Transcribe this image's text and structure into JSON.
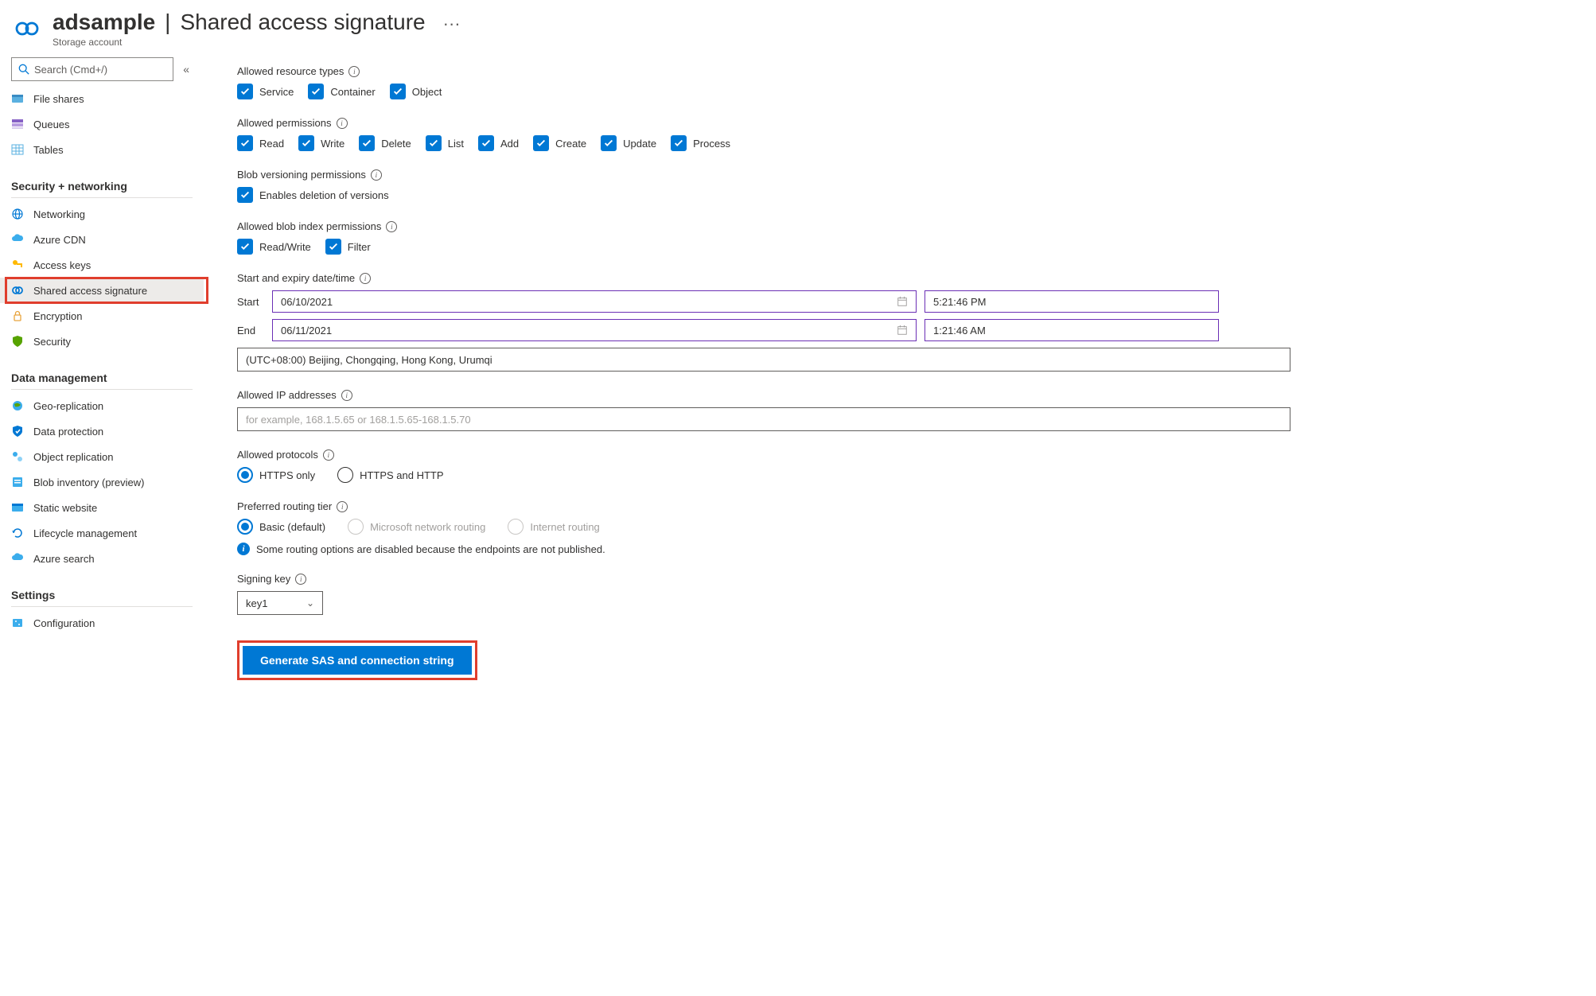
{
  "header": {
    "account_name": "adsample",
    "page_title": "Shared access signature",
    "subtitle": "Storage account"
  },
  "sidebar": {
    "search_placeholder": "Search (Cmd+/)",
    "top_items": [
      {
        "label": "File shares"
      },
      {
        "label": "Queues"
      },
      {
        "label": "Tables"
      }
    ],
    "security_section": {
      "title": "Security + networking",
      "items": [
        {
          "label": "Networking"
        },
        {
          "label": "Azure CDN"
        },
        {
          "label": "Access keys"
        },
        {
          "label": "Shared access signature"
        },
        {
          "label": "Encryption"
        },
        {
          "label": "Security"
        }
      ]
    },
    "data_section": {
      "title": "Data management",
      "items": [
        {
          "label": "Geo-replication"
        },
        {
          "label": "Data protection"
        },
        {
          "label": "Object replication"
        },
        {
          "label": "Blob inventory (preview)"
        },
        {
          "label": "Static website"
        },
        {
          "label": "Lifecycle management"
        },
        {
          "label": "Azure search"
        }
      ]
    },
    "settings_section": {
      "title": "Settings",
      "items": [
        {
          "label": "Configuration"
        }
      ]
    }
  },
  "main": {
    "allowed_resource_types": {
      "label": "Allowed resource types",
      "options": [
        "Service",
        "Container",
        "Object"
      ]
    },
    "allowed_permissions": {
      "label": "Allowed permissions",
      "options": [
        "Read",
        "Write",
        "Delete",
        "List",
        "Add",
        "Create",
        "Update",
        "Process"
      ]
    },
    "blob_versioning": {
      "label": "Blob versioning permissions",
      "option": "Enables deletion of versions"
    },
    "blob_index": {
      "label": "Allowed blob index permissions",
      "options": [
        "Read/Write",
        "Filter"
      ]
    },
    "datetime": {
      "label": "Start and expiry date/time",
      "start_label": "Start",
      "end_label": "End",
      "start_date": "06/10/2021",
      "start_time": "5:21:46 PM",
      "end_date": "06/11/2021",
      "end_time": "1:21:46 AM",
      "timezone": "(UTC+08:00) Beijing, Chongqing, Hong Kong, Urumqi"
    },
    "ip": {
      "label": "Allowed IP addresses",
      "placeholder": "for example, 168.1.5.65 or 168.1.5.65-168.1.5.70"
    },
    "protocols": {
      "label": "Allowed protocols",
      "options": [
        "HTTPS only",
        "HTTPS and HTTP"
      ]
    },
    "routing": {
      "label": "Preferred routing tier",
      "options": [
        "Basic (default)",
        "Microsoft network routing",
        "Internet routing"
      ],
      "info_message": "Some routing options are disabled because the endpoints are not published."
    },
    "signing_key": {
      "label": "Signing key",
      "value": "key1"
    },
    "generate_button": "Generate SAS and connection string"
  }
}
